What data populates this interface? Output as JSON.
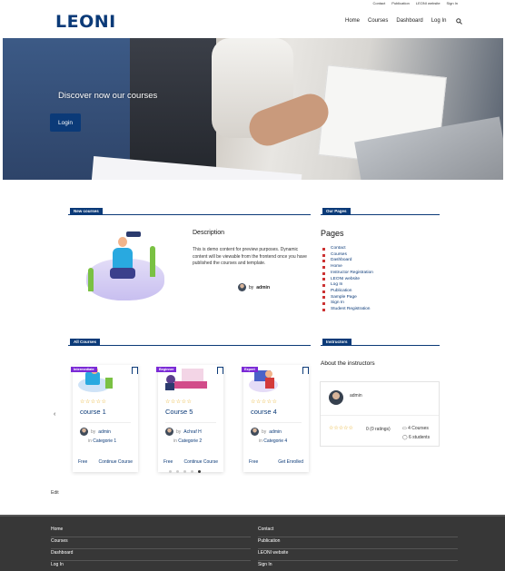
{
  "topbar": {
    "links": [
      "Contact",
      "Publication",
      "LEONI website",
      "Sign In"
    ]
  },
  "header": {
    "logo": "LEONI",
    "nav": [
      "Home",
      "Courses",
      "Dashboard",
      "Log In"
    ],
    "search_icon": "search-icon"
  },
  "hero": {
    "title": "Discover now our courses",
    "button": "Login"
  },
  "new_courses": {
    "section_title": "New courses",
    "description_title": "Description",
    "description_text": "This is demo content for preview purposes. Dynamic content will be viewable from the frontend once you have published the courses and template.",
    "by": "by",
    "author": "admin"
  },
  "our_pages": {
    "section_title": "Our Pages",
    "title": "Pages",
    "items": [
      "Contact",
      "Courses",
      "Dashboard",
      "Home",
      "Instructor Registration",
      "LEONI website",
      "Log In",
      "Publication",
      "Sample Page",
      "Sign In",
      "Student Registration"
    ]
  },
  "all_courses": {
    "section_title": "All Courses",
    "cards": [
      {
        "level": "Intermediate",
        "stars": "☆☆☆☆☆",
        "title": "course 1",
        "by": "by",
        "author": "admin",
        "in": "in",
        "category": "Categorie 1",
        "price": "Free",
        "action": "Continue Course"
      },
      {
        "level": "Beginner",
        "stars": "☆☆☆☆☆",
        "title": "Course 5",
        "by": "by",
        "author": "Achraf H",
        "in": "in",
        "category": "Categorie 2",
        "price": "Free",
        "action": "Continue Course"
      },
      {
        "level": "Expert",
        "stars": "☆☆☆☆☆",
        "title": "course 4",
        "by": "by",
        "author": "admin",
        "in": "in",
        "category": "Categorie 4",
        "price": "Free",
        "action": "Get Enrolled"
      }
    ],
    "prev_icon": "chevron-left-icon",
    "next_icon": "chevron-right-icon",
    "active_dot": 5
  },
  "instructors": {
    "section_title": "Instructors",
    "subtitle": "About the instructors",
    "name": "admin",
    "stars": "☆☆☆☆☆",
    "rating": "0 (0 ratings)",
    "courses": "4 Courses",
    "students": "6 students"
  },
  "edit_link": "Edit",
  "footer": {
    "col1": [
      "Home",
      "Courses",
      "Dashboard",
      "Log In"
    ],
    "col2": [
      "Contact",
      "Publication",
      "LEONI website",
      "Sign In"
    ]
  }
}
